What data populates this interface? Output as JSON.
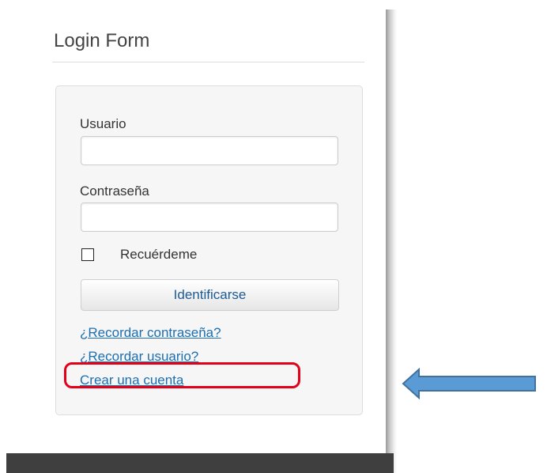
{
  "module": {
    "title": "Login Form"
  },
  "form": {
    "username_label": "Usuario",
    "username_value": "",
    "password_label": "Contraseña",
    "password_value": "",
    "remember_label": "Recuérdeme",
    "remember_checked": false,
    "submit_label": "Identificarse"
  },
  "links": {
    "forgot_password": "¿Recordar contraseña?",
    "forgot_username": "¿Recordar usuario?",
    "create_account": "Crear una cuenta"
  },
  "colors": {
    "link": "#1c6fb0",
    "button_text": "#1d5a93",
    "highlight": "#e3001b",
    "arrow_fill": "#5b9bd5",
    "arrow_stroke": "#41719c"
  },
  "annotation": {
    "highlight_target": "create-account-link",
    "arrow_direction": "left"
  }
}
